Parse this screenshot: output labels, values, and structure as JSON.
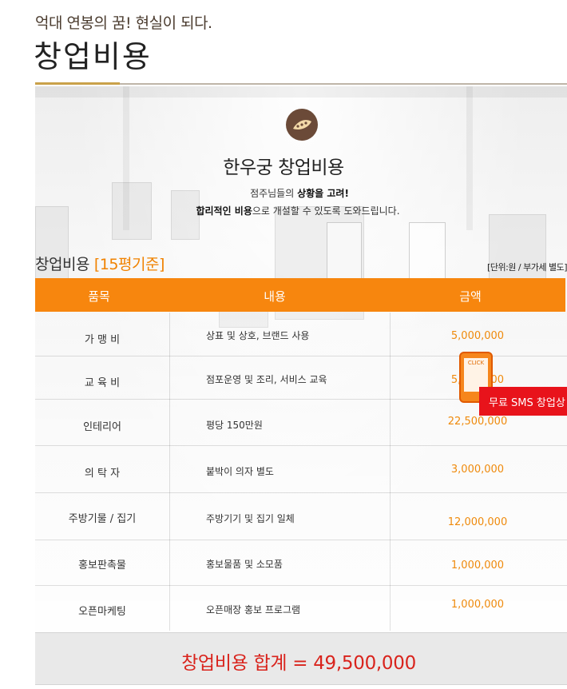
{
  "header": {
    "subtitle": "억대 연봉의 꿈! 현실이 되다.",
    "title": "창업비용"
  },
  "intro": {
    "brand_name": "한우궁 창업비용",
    "line1_prefix": "점주님들의 ",
    "line1_bold": "상황을 고려!",
    "line2_bold": "합리적인 비용",
    "line2_suffix": "으로 개설할 수 있도록 도와드립니다."
  },
  "section": {
    "title": "창업비용",
    "basis": "[15평기준]",
    "unit_note": "[단위:원 / 부가세 별도]"
  },
  "table": {
    "headers": [
      "품목",
      "내용",
      "금액"
    ],
    "rows": [
      {
        "item": "가 맹 비",
        "desc": "상표 및 상호, 브랜드 사용",
        "amount": "5,000,000"
      },
      {
        "item": "교 육 비",
        "desc": "점포운영 및 조리, 서비스 교육",
        "amount": "5,000,000"
      },
      {
        "item": "인테리어",
        "desc": "평당 150만원",
        "amount": "22,500,000"
      },
      {
        "item": "의 탁 자",
        "desc": "붙박이 의자 별도",
        "amount": "3,000,000"
      },
      {
        "item": "주방기물 / 집기",
        "desc": "주방기기 및 집기 일체",
        "amount": "12,000,000"
      },
      {
        "item": "홍보판촉물",
        "desc": "홍보물품 및 소모품",
        "amount": "1,000,000"
      },
      {
        "item": "오픈마케팅",
        "desc": "오픈매장 홍보 프로그램",
        "amount": "1,000,000"
      }
    ]
  },
  "sms": {
    "click_label": "CLICK",
    "banner": "무료 SMS 창업상"
  },
  "total": {
    "text": "창업비용 합계  =  49,500,000"
  },
  "colors": {
    "accent_orange": "#f7860e",
    "amount_orange": "#ef8a0c",
    "total_red": "#d9231c",
    "sms_red": "#e8131b",
    "rule_gold": "#c9a14a",
    "badge_brown": "#6b4a38"
  }
}
